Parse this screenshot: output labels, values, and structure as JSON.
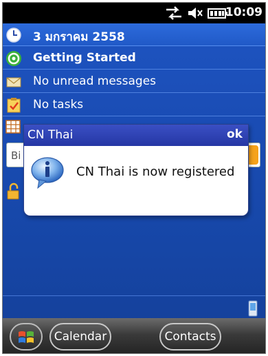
{
  "status_bar": {
    "time": "10:09",
    "icons": [
      "data-sync-icon",
      "speaker-icon",
      "battery-icon"
    ]
  },
  "today": {
    "rows": [
      {
        "icon": "clock-icon",
        "label": "3 มกราคม 2558",
        "bold": true
      },
      {
        "icon": "getting-started-icon",
        "label": "Getting Started",
        "bold": true
      },
      {
        "icon": "envelope-icon",
        "label": "No unread messages",
        "bold": false
      },
      {
        "icon": "tasks-icon",
        "label": "No tasks",
        "bold": false
      }
    ],
    "search_placeholder": "Bi"
  },
  "dialog": {
    "title": "CN Thai",
    "ok_label": "ok",
    "message": "CN Thai is now registered",
    "icon": "info-icon"
  },
  "softkeys": {
    "left": "Calendar",
    "right": "Contacts"
  },
  "colors": {
    "background": "#1a4cb4",
    "dialog_titlebar": "#2537a4",
    "accent_orange": "#f5a21a"
  }
}
